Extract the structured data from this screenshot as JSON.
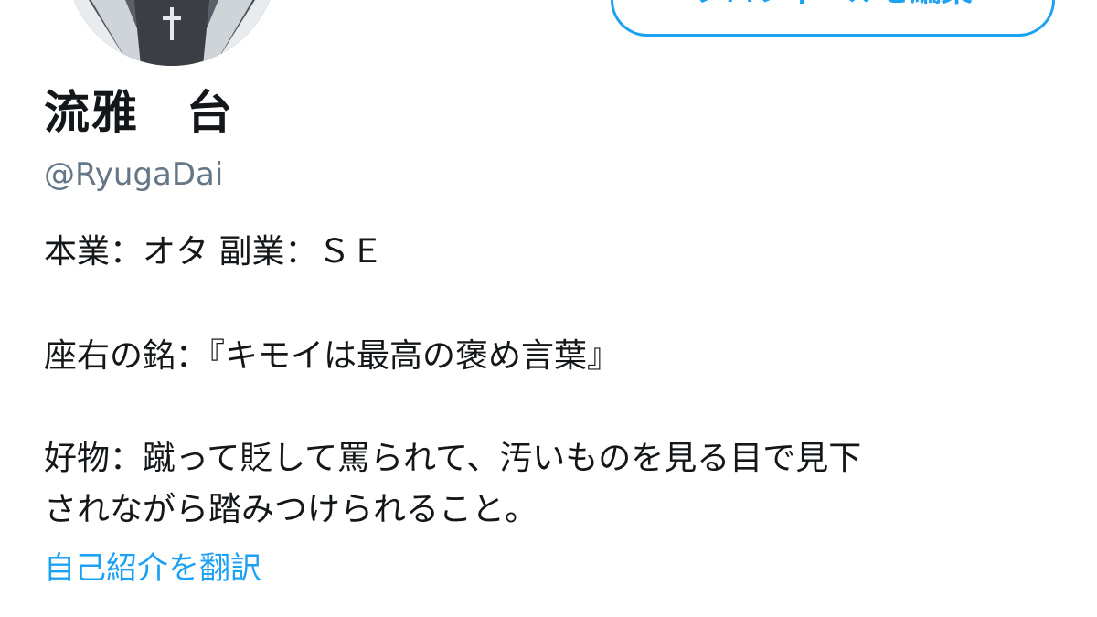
{
  "profile": {
    "display_name": "流雅　台",
    "screen_name": "@RyugaDai",
    "edit_button_label": "プロフィールを編集",
    "bio_lines": [
      "本業：オタ 副業：ＳＥ",
      "座右の銘：『キモイは最高の褒め言葉』",
      "好物：蹴って貶して罵られて、汚いものを見る目で見下",
      "されながら踏みつけられること。"
    ],
    "translate_label": "自己紹介を翻訳"
  },
  "colors": {
    "accent": "#1da1f2",
    "secondary_text": "#657786",
    "primary_text": "#14171a",
    "background": "#ffffff"
  }
}
